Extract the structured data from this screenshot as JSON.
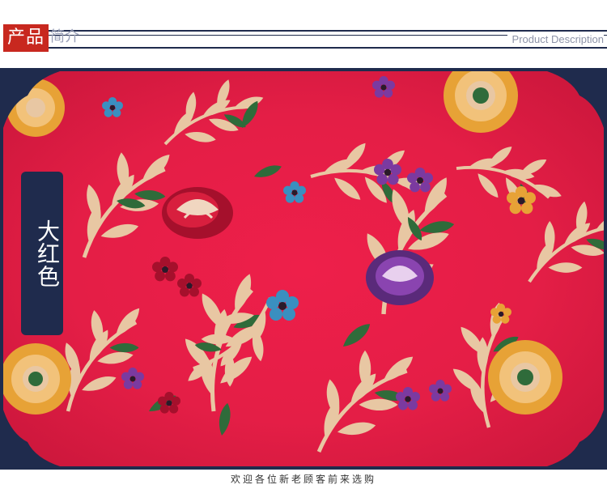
{
  "header": {
    "title_badge": "产品",
    "title_sub": "简介",
    "english_subtitle": "Product Description"
  },
  "product": {
    "color_label": "大红色"
  },
  "footer": {
    "tagline": "欢迎各位新老顾客前来选购"
  },
  "colors": {
    "frame_navy": "#1f2b4d",
    "badge_red": "#c8281f",
    "fabric_red": "#e41e46",
    "gold": "#e7a236",
    "cream": "#e8c7a3",
    "leaf_green": "#2f6b3a",
    "purple": "#7b3aa0",
    "blue": "#3a8fc0"
  },
  "icons": [
    "fabric-pattern",
    "corner-ornament-icon",
    "peony-icon",
    "leaf-icon"
  ]
}
